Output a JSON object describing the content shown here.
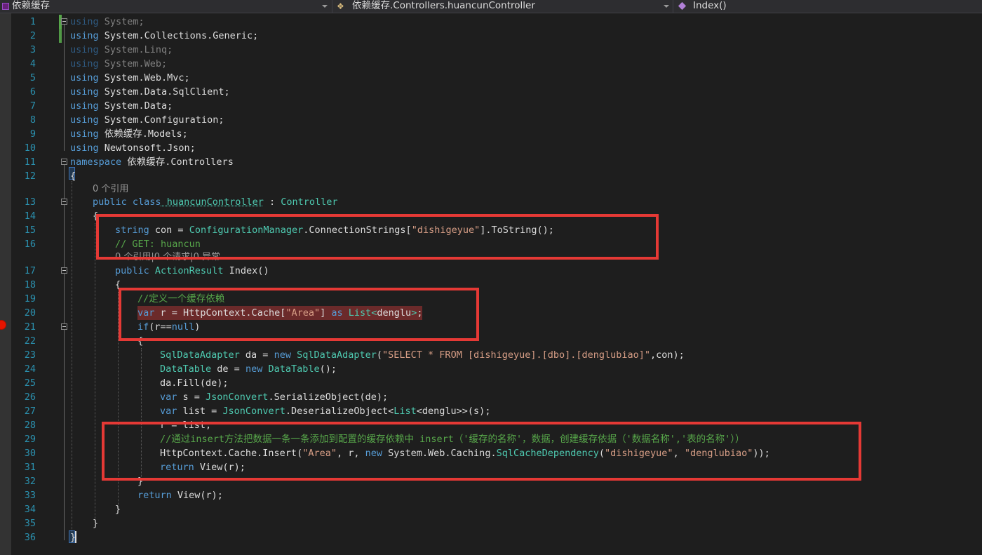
{
  "navigation_bar": {
    "project": "依赖缓存",
    "class": "依赖缓存.Controllers.huancunController",
    "member": "Index()",
    "icons": {
      "project": "csharp-project-icon",
      "class": "class-icon",
      "member": "method-icon"
    }
  },
  "editor": {
    "line_numbers": [
      "1",
      "2",
      "3",
      "4",
      "5",
      "6",
      "7",
      "8",
      "9",
      "10",
      "11",
      "12",
      "13",
      "14",
      "15",
      "16",
      "17",
      "18",
      "19",
      "20",
      "21",
      "22",
      "23",
      "24",
      "25",
      "26",
      "27",
      "28",
      "29",
      "30",
      "31",
      "32",
      "33",
      "34",
      "35",
      "36"
    ],
    "reference_lens": {
      "class": "0 个引用",
      "index_partial": "0 个引用|0 个请求|0 异常"
    },
    "lines": {
      "l1": {
        "kw": "using",
        "rest": " System;"
      },
      "l2": {
        "kw": "using",
        "rest": " System.Collections.Generic;"
      },
      "l3": {
        "kw": "using",
        "rest": " System.Linq;"
      },
      "l4": {
        "kw": "using",
        "rest": " System.Web;"
      },
      "l5": {
        "kw": "using",
        "rest": " System.Web.Mvc;"
      },
      "l6": {
        "kw": "using",
        "rest": " System.Data.SqlClient;"
      },
      "l7": {
        "kw": "using",
        "rest": " System.Data;"
      },
      "l8": {
        "kw": "using",
        "rest": " System.Configuration;"
      },
      "l9": {
        "kw": "using",
        "rest": " 依赖缓存.Models;"
      },
      "l10": {
        "kw": "using",
        "rest": " Newtonsoft.Json;"
      },
      "l11": {
        "kw": "namespace",
        "rest": " 依赖缓存.Controllers"
      },
      "l12": {
        "text": "{"
      },
      "l13": {
        "kw1": "public",
        "kw2": " class",
        "name": " huancunController",
        "colon": " : ",
        "base": "Controller"
      },
      "l14": {
        "text": "{"
      },
      "l15": {
        "kw": "string",
        "a": " con = ",
        "ty": "ConfigurationManager",
        "b": ".ConnectionStrings[",
        "st": "\"dishigeyue\"",
        "c": "].ToString();"
      },
      "l16": {
        "comment": "// GET: huancun"
      },
      "l17": {
        "kw": "public",
        "ty": " ActionResult",
        "rest": " Index()"
      },
      "l18": {
        "text": "{"
      },
      "l19": {
        "comment": "//定义一个缓存依赖"
      },
      "l20": {
        "kw": "var",
        "a": " r = HttpContext.Cache[",
        "st": "\"Area\"",
        "b": "] ",
        "kw2": "as",
        "ty": " List<",
        "c": "denglu",
        "ty2": ">",
        "d": ";"
      },
      "l21": {
        "kw": "if",
        "a": "(r==",
        "kw2": "null",
        "b": ")"
      },
      "l22": {
        "text": "{"
      },
      "l23": {
        "ty": "SqlDataAdapter",
        "a": " da = ",
        "kw": "new",
        "ty2": " SqlDataAdapter",
        "b": "(",
        "st": "\"SELECT * FROM [dishigeyue].[dbo].[denglubiao]\"",
        "c": ",con);"
      },
      "l24": {
        "ty": "DataTable",
        "a": " de = ",
        "kw": "new",
        "ty2": " DataTable",
        "b": "();"
      },
      "l25": {
        "text": "da.Fill(de);"
      },
      "l26": {
        "kw": "var",
        "a": " s = ",
        "ty": "JsonConvert",
        "b": ".SerializeObject(de);"
      },
      "l27": {
        "kw": "var",
        "a": " list = ",
        "ty": "JsonConvert",
        "b": ".DeserializeObject<",
        "ty2": "List",
        "c": "<denglu>>(s);"
      },
      "l28": {
        "text": "r = list;"
      },
      "l29": {
        "comment": "//通过insert方法把数据一条一条添加到配置的缓存依赖中 insert（'缓存的名称'，数据，创建缓存依据（'数据名称','表的名称'））"
      },
      "l30": {
        "a": "HttpContext.Cache.Insert(",
        "st": "\"Area\"",
        "b": ", r, ",
        "kw": "new",
        "c": " System.Web.Caching.",
        "ty": "SqlCacheDependency",
        "d": "(",
        "st2": "\"dishigeyue\"",
        "e": ", ",
        "st3": "\"denglubiao\"",
        "f": "));"
      },
      "l31": {
        "kw": "return",
        "rest": " View(r);"
      },
      "l32": {
        "text": "}"
      },
      "l33": {
        "kw": "return",
        "rest": " View(r);"
      },
      "l34": {
        "text": "}"
      },
      "l35": {
        "text": "}"
      },
      "l36": {
        "text": "}"
      }
    }
  },
  "colors": {
    "background": "#1e1e1e",
    "keyword": "#569cd6",
    "type": "#4ec9b0",
    "string": "#d69d85",
    "comment": "#57a64a",
    "line_number": "#2b91af",
    "annotation_box": "#e53935",
    "breakpoint": "#e51400"
  }
}
